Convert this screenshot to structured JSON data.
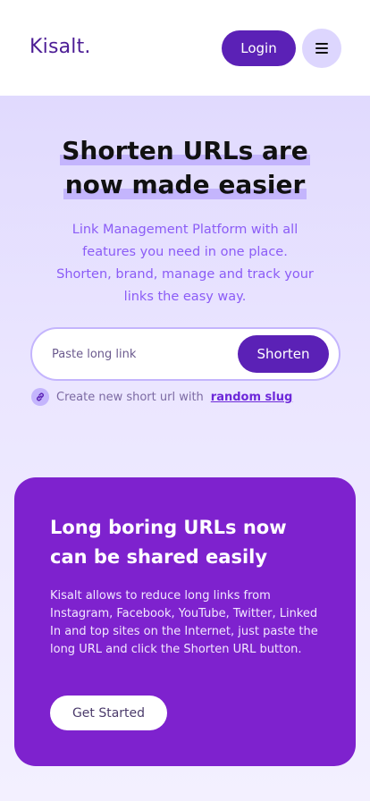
{
  "header": {
    "brand": "Kisalt.",
    "login_label": "Login",
    "menu_icon": "hamburger-icon"
  },
  "hero": {
    "title_line1": "Shorten URLs are",
    "title_line2": "now made easier",
    "description": "Link Management Platform with all features you need in one place. Shorten, brand, manage and track your links the easy way.",
    "highlight_color": "#c4b5fd"
  },
  "shortener": {
    "placeholder": "Paste long link",
    "button_label": "Shorten",
    "helper_text": "Create new short url with",
    "helper_link": "random slug",
    "helper_icon": "link-icon"
  },
  "card": {
    "title": "Long boring URLs now can be shared easily",
    "text": "Kisalt allows to reduce long links from Instagram, Facebook, YouTube, Twitter, Linked In and top sites on the Internet, just paste the long URL and click the Shorten URL button.",
    "button_label": "Get Started",
    "background": "#7e22ce"
  },
  "colors": {
    "accent": "#5b21b6",
    "brand": "#4c1d95"
  }
}
